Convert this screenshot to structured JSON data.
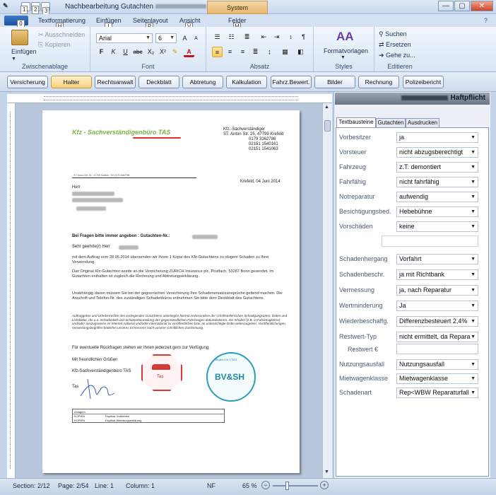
{
  "window": {
    "title_left": "Nachbearbeitung Gutachten",
    "title_right": "aftpflicht",
    "context_tab": "System Textbausteine",
    "controls": [
      "—",
      "▢",
      "✕"
    ],
    "qat_tips": [
      "1",
      "2",
      "3"
    ]
  },
  "ribbon": {
    "file_label": "",
    "file_tip": "0",
    "tabs": [
      {
        "label": "Textformatierung",
        "tip": "H"
      },
      {
        "label": "Einfügen",
        "tip": "I"
      },
      {
        "label": "Seitenlayout",
        "tip": "P"
      },
      {
        "label": "Ansicht",
        "tip": "V"
      },
      {
        "label": "Felder",
        "tip": "M"
      }
    ],
    "clipboard": {
      "paste": "Einfügen",
      "cut": "Ausschneiden",
      "copy": "Kopieren",
      "group": "Zwischenablage"
    },
    "font": {
      "name": "Arial",
      "size": "6",
      "group": "Font",
      "buttons": [
        "F",
        "K",
        "U",
        "abc",
        "X₂",
        "X²"
      ]
    },
    "paragraph": {
      "group": "Absatz"
    },
    "styles": {
      "label": "Formatvorlagen",
      "group": "Styles"
    },
    "editing": {
      "search": "Suchen",
      "replace": "Ersetzen",
      "goto": "Gehe zu...",
      "group": "Editieren"
    }
  },
  "docbar": {
    "buttons": [
      "Versicherung",
      "Halter",
      "Rechtsanwalt",
      "Deckblatt",
      "Abtretung",
      "Kalkulation",
      "Fahrz.Bewert.",
      "Bilder",
      "Rechnung",
      "Polizeibericht"
    ],
    "active": "Halter"
  },
  "letter": {
    "brand": "Kfz - Sachverständigenbüro TAS",
    "sender": [
      "Kfz.-Sachverständiger",
      "ST. Anton Str. 25, 47799 Krefeld",
      "0179 3362786",
      "02151 1540161",
      "02151 1541063"
    ],
    "date": "Krefeld, 04 Juni 2014",
    "herr": "Herr",
    "ref": "Bei Fragen bitte immer angeben  : Gutachten-Nr.:",
    "salutation": "Sehr geehrte(r) Herr",
    "p1": "mit dem Auftrag vom 28.05.2014 übersenden wir Ihnen 1 Kopie des Kfz-Gutachtens zu obigem Schaden zu Ihrer Verwendung.",
    "p2": "Das Original Kfz-Gutachten wurde an die Versicherung ZURICH Insurance plc, Postfach, 53287  Bonn gesendet. Im Gutachten enthalten ist zugleich die Rechnung und Abtretungserklärung.",
    "p3": "Unabhängig davon müssen Sie bei der gegnerischen Versicherung Ihre Schadenersatzsansprüche geltend machen. Die Anschrift und Telefon-Nr. des zuständigen Schadenbüros entnehmen Sie bitte dem Deckblatt des Gutachtens.",
    "p4": "Auftraggeber und Urheberrechte des vorliegenden Gutachtens unterliegen hiermit insbesondere der schriftstellerischen Schadigungsarten, Daten und Lichtbilder, die u.a. Schadenbild und Schadenbeurteilung des gegenständlichen Fahrzeuges dokumentieren, der Inhaber (z.B. in Fahrzeugbörse) und/oder auszugsweise im Internet national und/oder international zu veröffentlichen bzw. an unberechtigte Dritte weiterzugeben. Veröffentlichungen, Verwertungsbegriffen bedürfen unseres Ermessens nach unserer schriftlichen Zustimmung.",
    "closing_q": "Für eventuelle Rückfragen stehen wir Ihnen jederzeit gern zur Verfügung.",
    "greeting": "Mit freundlichen Grüßen",
    "signoff": "Kfz-Sachverständigenbüro TAS",
    "sig_prefix": "Tas",
    "stamp1": "Tas",
    "stamp2": "BV&SH",
    "stamp2_top": "Mitglied-Nr.17823",
    "annex_head": "Anlage/n",
    "annex": [
      {
        "k": "KOPIEN",
        "v": "Duplikat Gutachten"
      },
      {
        "k": "KOPIEN",
        "v": "Duplikat Abtretungserklärung"
      }
    ],
    "tiny_sender": "- ST. Anton Str. 25 - 47799 Krefeld - Tel 0179 3362786"
  },
  "panel": {
    "title": "Haftpflicht",
    "tabs": [
      "Textbausteine",
      "Gutachten",
      "Ausdrucken"
    ],
    "fields": [
      {
        "label": "Vorbesitzer",
        "value": "ja"
      },
      {
        "label": "Vorsteuer",
        "value": "nicht abzugsberechtigt"
      },
      {
        "label": "Fahrzeug",
        "value": "z.T. demontiert"
      },
      {
        "label": "Fahrfähig",
        "value": "nicht fahrfähig"
      },
      {
        "label": "Notreparatur",
        "value": "aufwendig"
      },
      {
        "label": "Besichtigungsbed.",
        "value": "Hebebühne"
      },
      {
        "label": "Vorschäden",
        "value": "keine"
      },
      {
        "label": "Schadenhergang",
        "value": "Vorfahrt"
      },
      {
        "label": "Schadenbeschr.",
        "value": "ja mit Richtbank"
      },
      {
        "label": "Vermessung",
        "value": "ja, nach Reparatur"
      },
      {
        "label": "Wertminderung",
        "value": "Ja"
      },
      {
        "label": "Wiederbeschaffg.",
        "value": "Differenzbesteuert 2,4%"
      },
      {
        "label": "Restwert-Typ",
        "value": "nicht ermittelt, da Repara"
      },
      {
        "label": "Restwert €",
        "value": ""
      },
      {
        "label": "Nutzungsausfall",
        "value": "Nutzungsausfall"
      },
      {
        "label": "Mietwagenklasse",
        "value": "Mietwagenklasse"
      },
      {
        "label": "Schadenart",
        "value": "Rep<WBW Reparaturfall"
      }
    ]
  },
  "status": {
    "section": "Section: 2/12",
    "page": "Page: 2/54",
    "line": "Line: 1",
    "column": "Column: 1",
    "nf": "NF",
    "zoom": "65 %",
    "zoom_fraction": 0.65
  }
}
